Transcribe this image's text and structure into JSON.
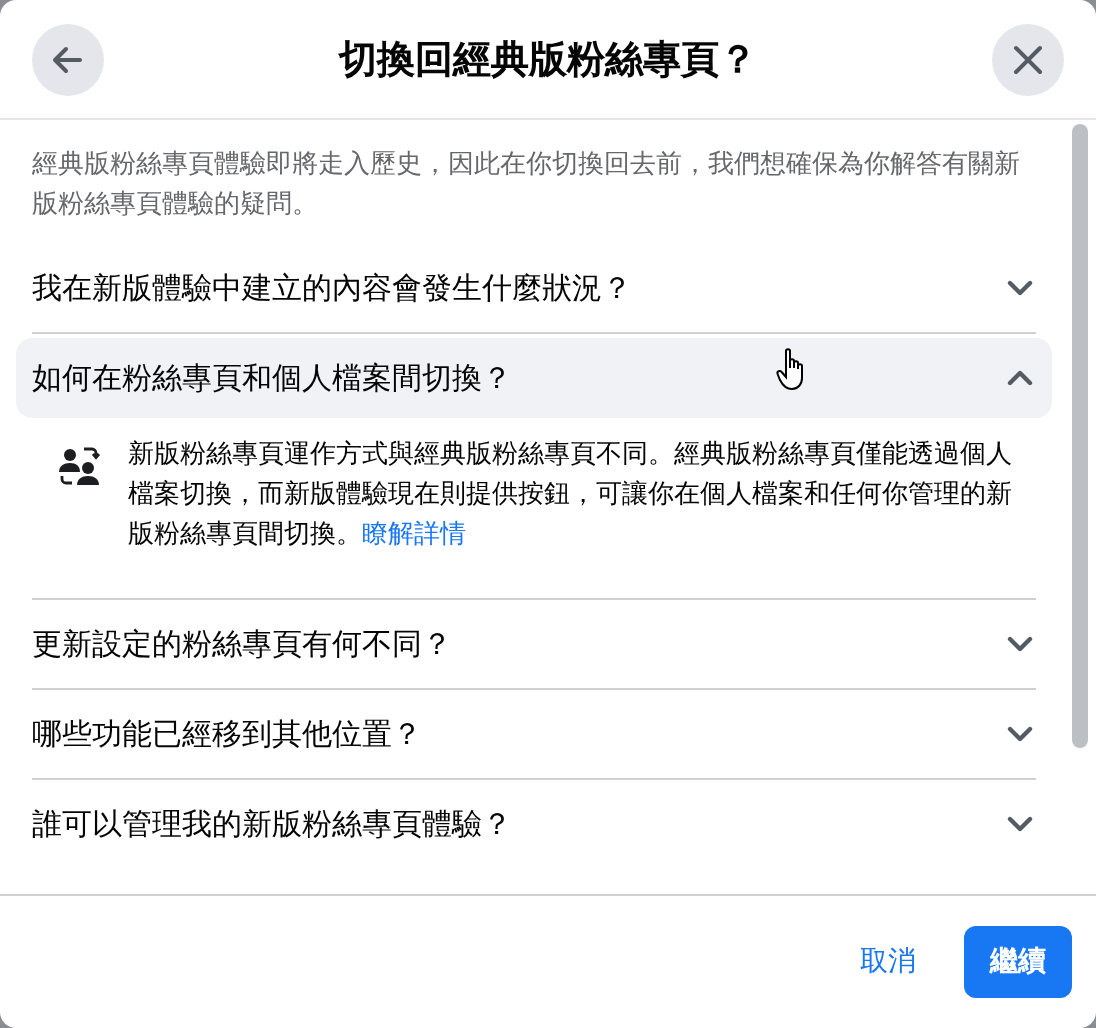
{
  "dialog": {
    "title": "切換回經典版粉絲專頁？"
  },
  "intro": "經典版粉絲專頁體驗即將走入歷史，因此在你切換回去前，我們想確保為你解答有關新版粉絲專頁體驗的疑問。",
  "faq": [
    {
      "question": "我在新版體驗中建立的內容會發生什麼狀況？",
      "expanded": false
    },
    {
      "question": "如何在粉絲專頁和個人檔案間切換？",
      "expanded": true,
      "answer": "新版粉絲專頁運作方式與經典版粉絲專頁不同。經典版粉絲專頁僅能透過個人檔案切換，而新版體驗現在則提供按鈕，可讓你在個人檔案和任何你管理的新版粉絲專頁間切換。",
      "link": "瞭解詳情"
    },
    {
      "question": "更新設定的粉絲專頁有何不同？",
      "expanded": false
    },
    {
      "question": "哪些功能已經移到其他位置？",
      "expanded": false
    },
    {
      "question": "誰可以管理我的新版粉絲專頁體驗？",
      "expanded": false
    }
  ],
  "buttons": {
    "cancel": "取消",
    "continue": "繼續"
  }
}
